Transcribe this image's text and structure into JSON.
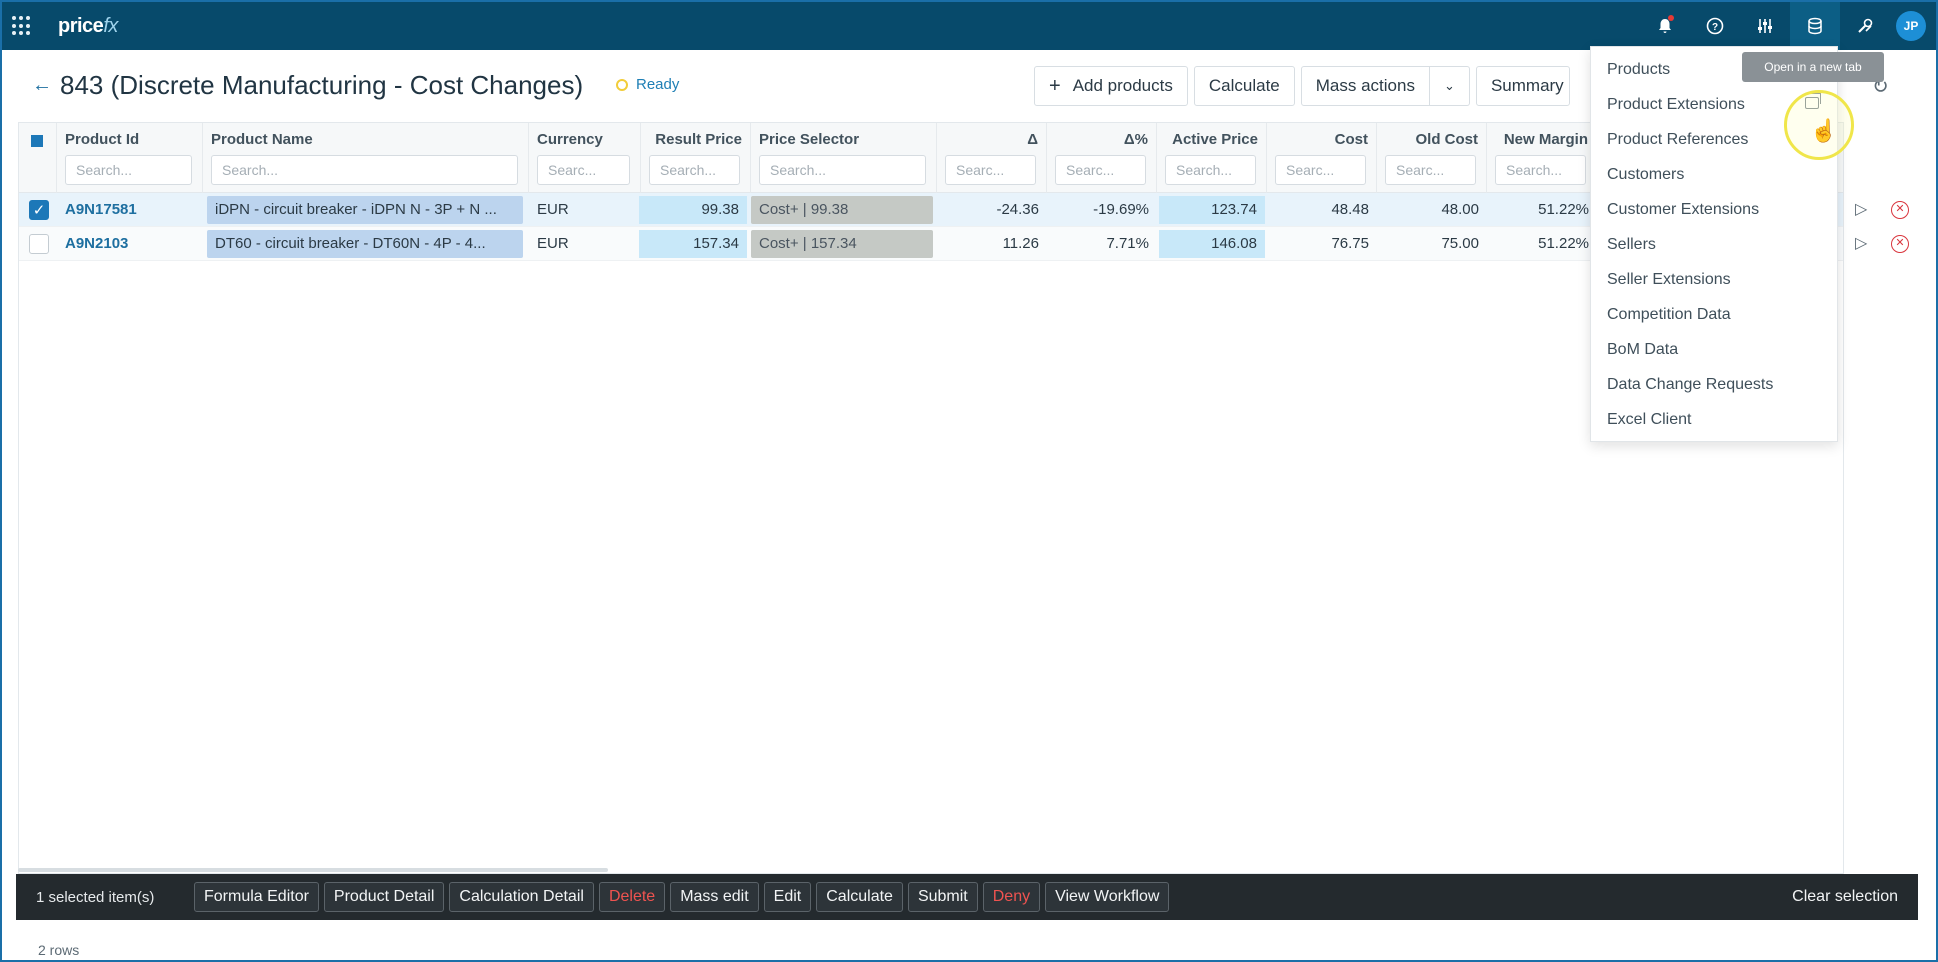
{
  "app": {
    "logo": "price",
    "logo_suffix": "fx",
    "avatar": "JP"
  },
  "page": {
    "title": "843 (Discrete Manufacturing - Cost Changes)",
    "status": "Ready"
  },
  "actions": {
    "add_products": "Add products",
    "calculate": "Calculate",
    "mass_actions": "Mass actions",
    "summary": "Summary"
  },
  "columns": [
    {
      "label": "Product Id",
      "placeholder": "Search..."
    },
    {
      "label": "Product Name",
      "placeholder": "Search..."
    },
    {
      "label": "Currency",
      "placeholder": "Searc..."
    },
    {
      "label": "Result Price",
      "placeholder": "Search..."
    },
    {
      "label": "Price Selector",
      "placeholder": "Search..."
    },
    {
      "label": "Δ",
      "placeholder": "Searc..."
    },
    {
      "label": "Δ%",
      "placeholder": "Searc..."
    },
    {
      "label": "Active Price",
      "placeholder": "Search..."
    },
    {
      "label": "Cost",
      "placeholder": "Searc..."
    },
    {
      "label": "Old Cost",
      "placeholder": "Searc..."
    },
    {
      "label": "New Margin",
      "placeholder": "Search..."
    }
  ],
  "rows": [
    {
      "selected": true,
      "product_id": "A9N17581",
      "product_name": "iDPN - circuit breaker - iDPN N - 3P + N ...",
      "currency": "EUR",
      "result_price": "99.38",
      "price_selector": "Cost+ | 99.38",
      "delta": "-24.36",
      "delta_pct": "-19.69%",
      "active_price": "123.74",
      "cost": "48.48",
      "old_cost": "48.00",
      "new_margin": "51.22%"
    },
    {
      "selected": false,
      "product_id": "A9N2103",
      "product_name": "DT60 - circuit breaker - DT60N - 4P - 4...",
      "currency": "EUR",
      "result_price": "157.34",
      "price_selector": "Cost+ | 157.34",
      "delta": "11.26",
      "delta_pct": "7.71%",
      "active_price": "146.08",
      "cost": "76.75",
      "old_cost": "75.00",
      "new_margin": "51.22%"
    }
  ],
  "bottom_bar": {
    "selected_count": "1 selected item(s)",
    "buttons": [
      "Formula Editor",
      "Product Detail",
      "Calculation Detail",
      "Delete",
      "Mass edit",
      "Edit",
      "Calculate",
      "Submit",
      "Deny",
      "View Workflow"
    ],
    "clear": "Clear selection"
  },
  "rows_count": "2 rows",
  "menu": {
    "items": [
      "Products",
      "Product Extensions",
      "Product References",
      "Customers",
      "Customer Extensions",
      "Sellers",
      "Seller Extensions",
      "Competition Data",
      "BoM Data",
      "Data Change Requests",
      "Excel Client"
    ],
    "tooltip": "Open in a new tab"
  },
  "colors": {
    "topbar": "#074a6b",
    "accent": "#1d78b8",
    "danger": "#ef5350"
  }
}
